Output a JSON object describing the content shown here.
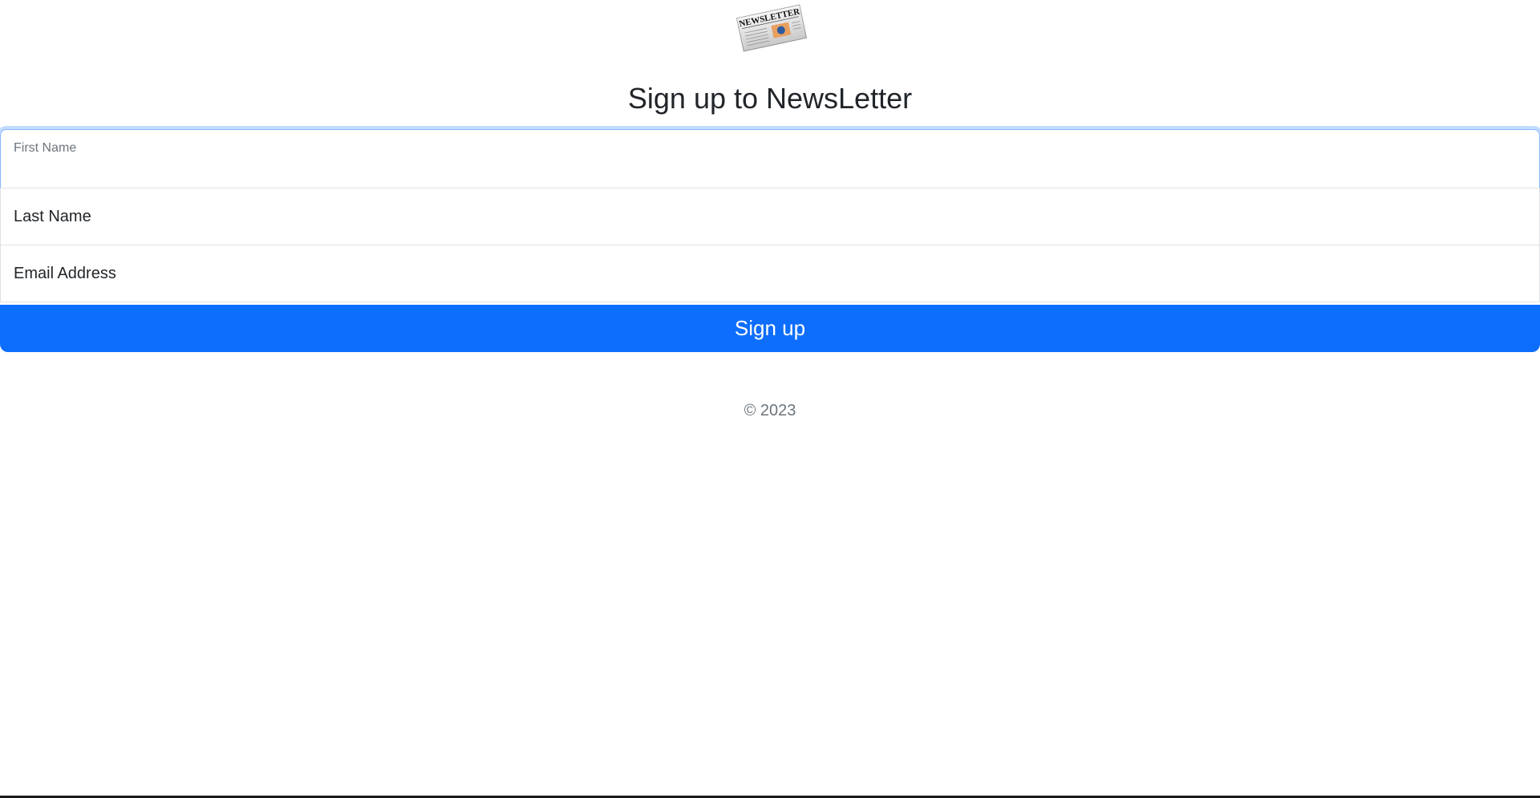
{
  "logo": {
    "masthead_text": "NEWSLETTER",
    "icon": "newspaper-logo"
  },
  "title": "Sign up to NewsLetter",
  "form": {
    "first_name_label": "First Name",
    "last_name_placeholder": "Last Name",
    "email_placeholder": "Email Address",
    "submit_label": "Sign up"
  },
  "footer": {
    "copyright": "© 2023"
  },
  "colors": {
    "primary": "#0d6efd",
    "focus_border": "#86b7fe",
    "text": "#212529",
    "muted": "#6c757d"
  }
}
